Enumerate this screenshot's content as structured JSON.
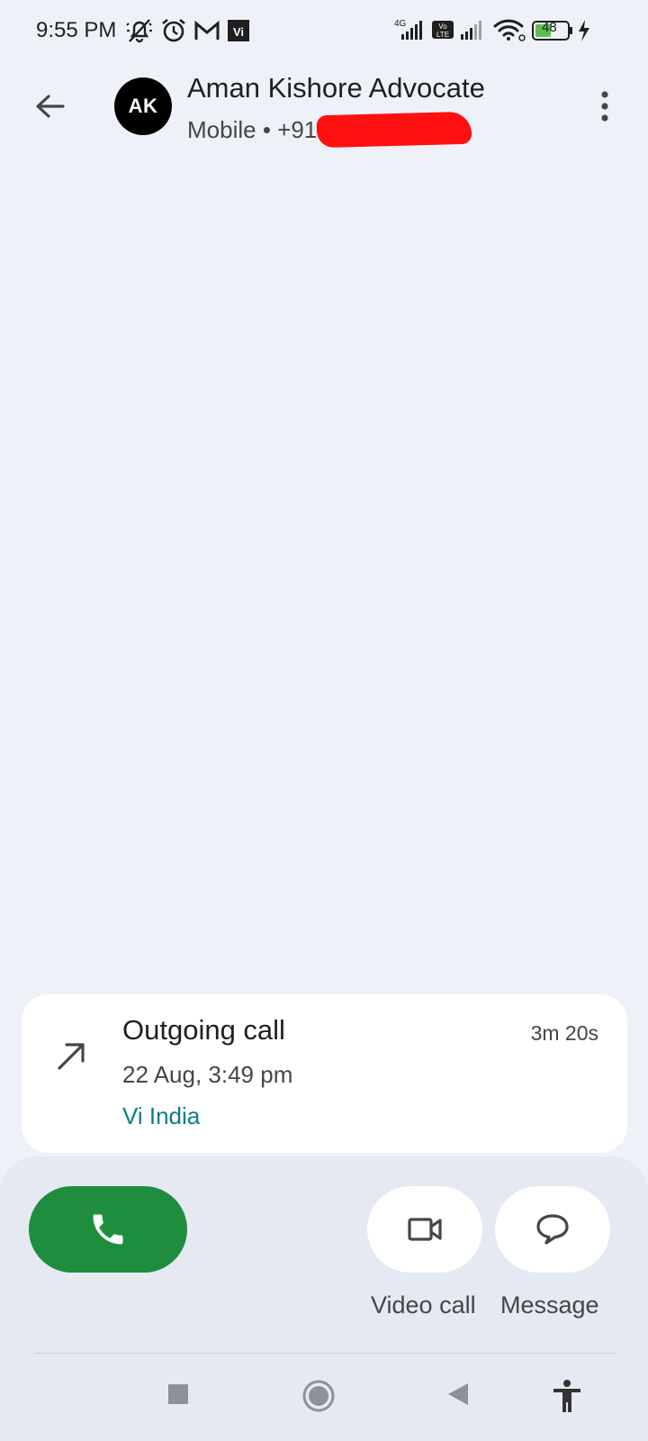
{
  "status_bar": {
    "time": "9:55 PM",
    "network_label": "4G",
    "volte_label": "Vo LTE",
    "battery_level": "48",
    "icons": [
      "mute-icon",
      "alarm-icon",
      "gmail-icon",
      "vi-app-icon",
      "signal-icon",
      "wifi-icon",
      "battery-icon",
      "charging-icon"
    ]
  },
  "header": {
    "avatar_initials": "AK",
    "contact_name": "Aman Kishore Advocate",
    "subtitle": "Mobile • +91"
  },
  "call_entry": {
    "type": "Outgoing call",
    "date": "22 Aug, 3:49 pm",
    "sim": "Vi India",
    "duration": "3m 20s"
  },
  "actions": {
    "video_call_label": "Video call",
    "message_label": "Message"
  },
  "colors": {
    "background": "#eef2f8",
    "call_button": "#1e8e3e",
    "sim_text": "#0b7d86",
    "redaction": "#ff1010"
  }
}
